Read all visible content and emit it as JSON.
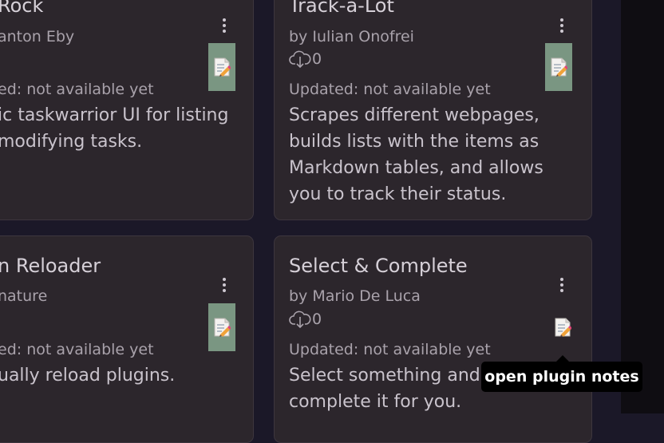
{
  "cards": [
    {
      "title": "Rock",
      "author": "anton Eby",
      "downloads": "",
      "updated": "ed: not available yet",
      "description": [
        "ic taskwarrior UI for listing",
        "modifying tasks."
      ]
    },
    {
      "title": "Track-a-Lot",
      "author": "by Iulian Onofrei",
      "downloads": "0",
      "updated": "Updated: not available yet",
      "description": [
        "Scrapes different webpages,",
        "builds lists with the items as",
        "Markdown tables, and allows",
        "you to track their status."
      ]
    },
    {
      "title": "n Reloader",
      "author": "nature",
      "downloads": "",
      "updated": "ed: not available yet",
      "description": [
        "ually reload plugins."
      ]
    },
    {
      "title": "Select & Complete",
      "author": "by Mario De Luca",
      "downloads": "0",
      "updated": "Updated: not available yet",
      "description": [
        "Select something and let AI",
        "complete it for you."
      ]
    }
  ],
  "tooltip": {
    "text": "open plugin notes"
  },
  "icons": {
    "menu": "more-vertical-icon",
    "notes": "notes-icon",
    "download": "cloud-download-icon"
  },
  "colors": {
    "card_bg": "#2c262c",
    "notes_btn_bg": "#7a9682",
    "page_bg": "#1b1828"
  }
}
